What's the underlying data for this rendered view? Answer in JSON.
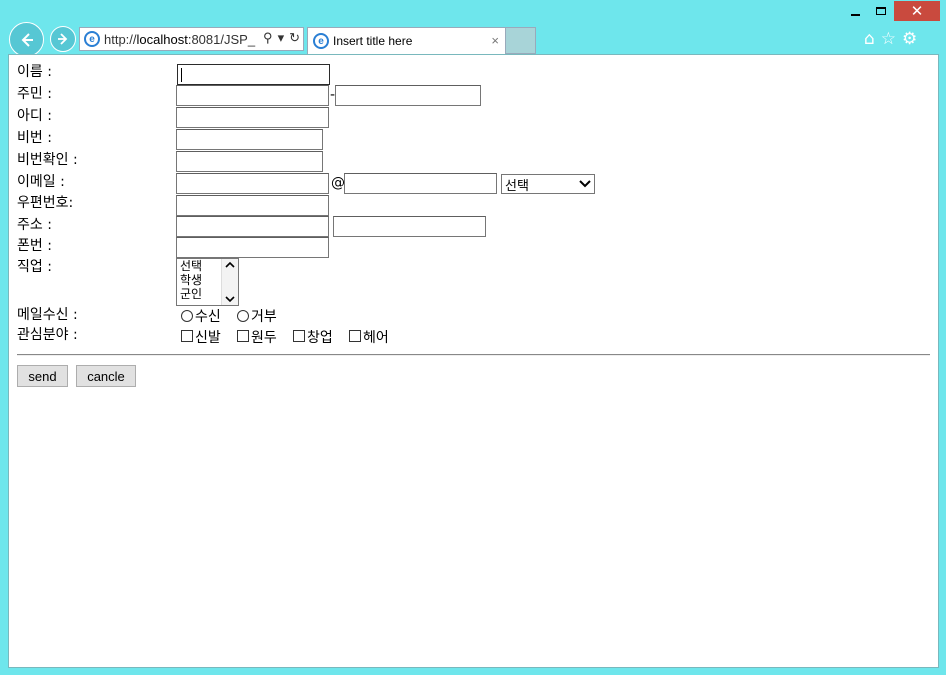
{
  "browser": {
    "address": {
      "scheme": "http://",
      "host": "localhost",
      "rest": ":8081/JSP_"
    },
    "tab_title": "Insert title here",
    "tab_close": "×"
  },
  "form": {
    "name_label": "이름 :",
    "jumin_label": "주민 :",
    "jumin_sep": "-",
    "id_label": "아디 :",
    "pw_label": "비번 :",
    "pw_confirm_label": "비번확인 :",
    "email_label": "이메일 :",
    "email_at": "@",
    "email_select": "선택",
    "zip_label": "우편번호:",
    "addr_label": "주소 :",
    "phone_label": "폰번 :",
    "job_label": "직업 :",
    "job_options": [
      "선택",
      "학생",
      "군인"
    ],
    "mail_label": "메일수신 :",
    "mail_yes": "수신",
    "mail_no": "거부",
    "interest_label": "관심분야 :",
    "interests": [
      "신발",
      "원두",
      "창업",
      "헤어"
    ],
    "send_label": "send",
    "cancel_label": "cancle"
  }
}
